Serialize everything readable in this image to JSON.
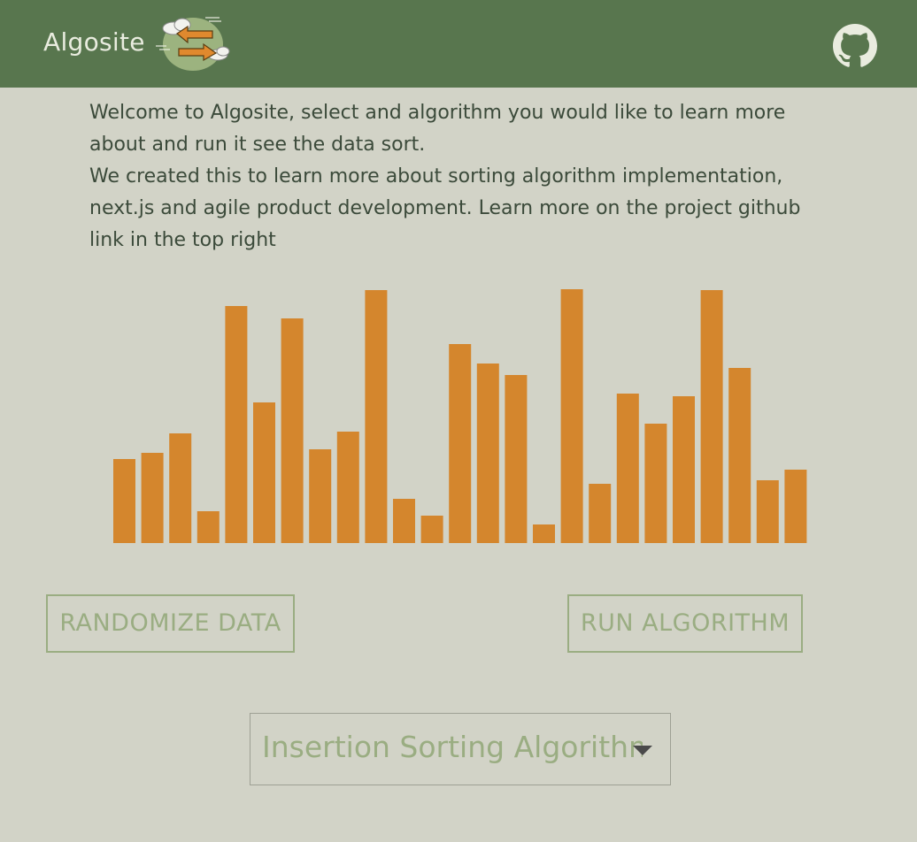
{
  "app": {
    "title": "Algosite",
    "logo_icon": "swap-arrows-cloud-icon",
    "github_icon": "github-icon"
  },
  "intro": {
    "line1": "Welcome to Algosite, select and algorithm you would like to learn more about and run it see the data sort.",
    "line2": "We created this to learn more about sorting algorithm implementation, next.js and agile product development. Learn more on the project github link in the top right"
  },
  "colors": {
    "header": "#58764e",
    "background": "#d2d3c7",
    "bar": "#d4862d",
    "accent": "#9aad82"
  },
  "controls": {
    "randomize_label": "RANDOMIZE DATA",
    "run_label": "RUN ALGORITHM",
    "algorithm_selected": "Insertion Sorting Algorithm"
  },
  "chart_data": {
    "type": "bar",
    "values": [
      95,
      102,
      124,
      36,
      268,
      159,
      254,
      106,
      126,
      286,
      50,
      31,
      225,
      203,
      190,
      21,
      287,
      67,
      169,
      135,
      166,
      286,
      198,
      71,
      83
    ],
    "ylim": [
      0,
      290
    ]
  }
}
